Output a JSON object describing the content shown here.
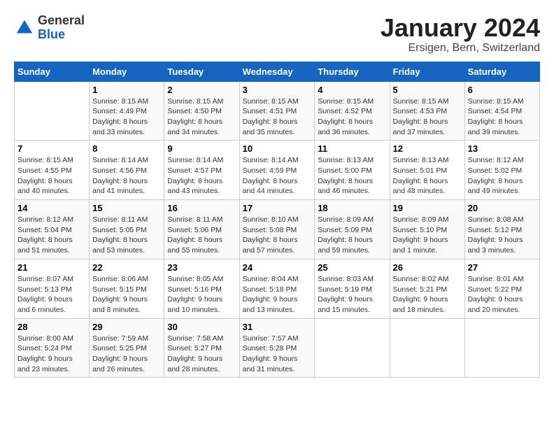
{
  "logo": {
    "general": "General",
    "blue": "Blue"
  },
  "title": "January 2024",
  "location": "Ersigen, Bern, Switzerland",
  "days_of_week": [
    "Sunday",
    "Monday",
    "Tuesday",
    "Wednesday",
    "Thursday",
    "Friday",
    "Saturday"
  ],
  "weeks": [
    [
      {
        "day": "",
        "info": ""
      },
      {
        "day": "1",
        "info": "Sunrise: 8:15 AM\nSunset: 4:49 PM\nDaylight: 8 hours\nand 33 minutes."
      },
      {
        "day": "2",
        "info": "Sunrise: 8:15 AM\nSunset: 4:50 PM\nDaylight: 8 hours\nand 34 minutes."
      },
      {
        "day": "3",
        "info": "Sunrise: 8:15 AM\nSunset: 4:51 PM\nDaylight: 8 hours\nand 35 minutes."
      },
      {
        "day": "4",
        "info": "Sunrise: 8:15 AM\nSunset: 4:52 PM\nDaylight: 8 hours\nand 36 minutes."
      },
      {
        "day": "5",
        "info": "Sunrise: 8:15 AM\nSunset: 4:53 PM\nDaylight: 8 hours\nand 37 minutes."
      },
      {
        "day": "6",
        "info": "Sunrise: 8:15 AM\nSunset: 4:54 PM\nDaylight: 8 hours\nand 39 minutes."
      }
    ],
    [
      {
        "day": "7",
        "info": "Sunrise: 8:15 AM\nSunset: 4:55 PM\nDaylight: 8 hours\nand 40 minutes."
      },
      {
        "day": "8",
        "info": "Sunrise: 8:14 AM\nSunset: 4:56 PM\nDaylight: 8 hours\nand 41 minutes."
      },
      {
        "day": "9",
        "info": "Sunrise: 8:14 AM\nSunset: 4:57 PM\nDaylight: 8 hours\nand 43 minutes."
      },
      {
        "day": "10",
        "info": "Sunrise: 8:14 AM\nSunset: 4:59 PM\nDaylight: 8 hours\nand 44 minutes."
      },
      {
        "day": "11",
        "info": "Sunrise: 8:13 AM\nSunset: 5:00 PM\nDaylight: 8 hours\nand 46 minutes."
      },
      {
        "day": "12",
        "info": "Sunrise: 8:13 AM\nSunset: 5:01 PM\nDaylight: 8 hours\nand 48 minutes."
      },
      {
        "day": "13",
        "info": "Sunrise: 8:12 AM\nSunset: 5:02 PM\nDaylight: 8 hours\nand 49 minutes."
      }
    ],
    [
      {
        "day": "14",
        "info": "Sunrise: 8:12 AM\nSunset: 5:04 PM\nDaylight: 8 hours\nand 51 minutes."
      },
      {
        "day": "15",
        "info": "Sunrise: 8:11 AM\nSunset: 5:05 PM\nDaylight: 8 hours\nand 53 minutes."
      },
      {
        "day": "16",
        "info": "Sunrise: 8:11 AM\nSunset: 5:06 PM\nDaylight: 8 hours\nand 55 minutes."
      },
      {
        "day": "17",
        "info": "Sunrise: 8:10 AM\nSunset: 5:08 PM\nDaylight: 8 hours\nand 57 minutes."
      },
      {
        "day": "18",
        "info": "Sunrise: 8:09 AM\nSunset: 5:09 PM\nDaylight: 8 hours\nand 59 minutes."
      },
      {
        "day": "19",
        "info": "Sunrise: 8:09 AM\nSunset: 5:10 PM\nDaylight: 9 hours\nand 1 minute."
      },
      {
        "day": "20",
        "info": "Sunrise: 8:08 AM\nSunset: 5:12 PM\nDaylight: 9 hours\nand 3 minutes."
      }
    ],
    [
      {
        "day": "21",
        "info": "Sunrise: 8:07 AM\nSunset: 5:13 PM\nDaylight: 9 hours\nand 6 minutes."
      },
      {
        "day": "22",
        "info": "Sunrise: 8:06 AM\nSunset: 5:15 PM\nDaylight: 9 hours\nand 8 minutes."
      },
      {
        "day": "23",
        "info": "Sunrise: 8:05 AM\nSunset: 5:16 PM\nDaylight: 9 hours\nand 10 minutes."
      },
      {
        "day": "24",
        "info": "Sunrise: 8:04 AM\nSunset: 5:18 PM\nDaylight: 9 hours\nand 13 minutes."
      },
      {
        "day": "25",
        "info": "Sunrise: 8:03 AM\nSunset: 5:19 PM\nDaylight: 9 hours\nand 15 minutes."
      },
      {
        "day": "26",
        "info": "Sunrise: 8:02 AM\nSunset: 5:21 PM\nDaylight: 9 hours\nand 18 minutes."
      },
      {
        "day": "27",
        "info": "Sunrise: 8:01 AM\nSunset: 5:22 PM\nDaylight: 9 hours\nand 20 minutes."
      }
    ],
    [
      {
        "day": "28",
        "info": "Sunrise: 8:00 AM\nSunset: 5:24 PM\nDaylight: 9 hours\nand 23 minutes."
      },
      {
        "day": "29",
        "info": "Sunrise: 7:59 AM\nSunset: 5:25 PM\nDaylight: 9 hours\nand 26 minutes."
      },
      {
        "day": "30",
        "info": "Sunrise: 7:58 AM\nSunset: 5:27 PM\nDaylight: 9 hours\nand 28 minutes."
      },
      {
        "day": "31",
        "info": "Sunrise: 7:57 AM\nSunset: 5:28 PM\nDaylight: 9 hours\nand 31 minutes."
      },
      {
        "day": "",
        "info": ""
      },
      {
        "day": "",
        "info": ""
      },
      {
        "day": "",
        "info": ""
      }
    ]
  ]
}
